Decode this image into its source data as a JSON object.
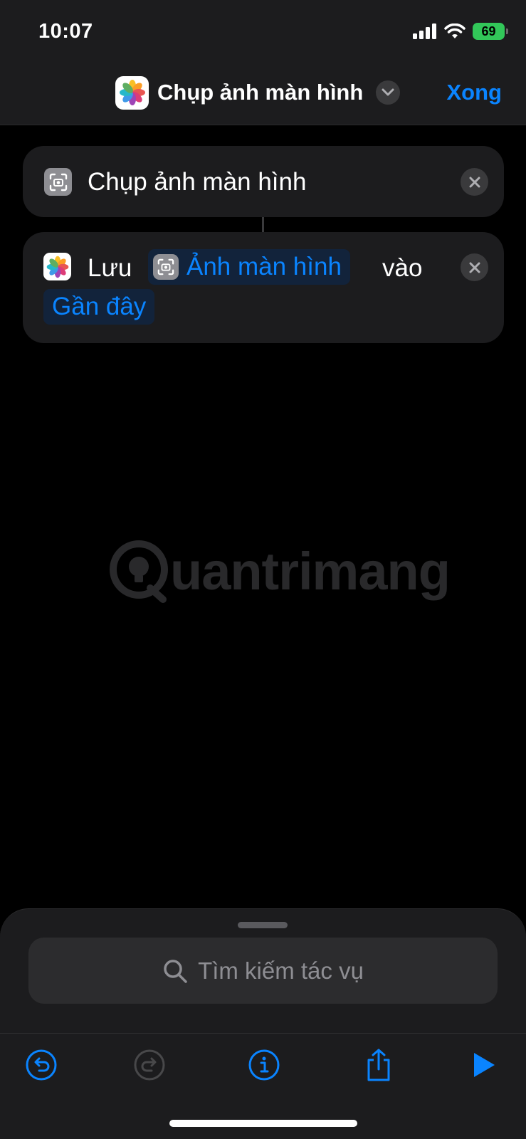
{
  "status_bar": {
    "time": "10:07",
    "battery": "69"
  },
  "nav": {
    "title": "Chụp ảnh màn hình",
    "done_label": "Xong"
  },
  "actions": [
    {
      "label": "Chụp ảnh màn hình"
    },
    {
      "prefix": "Lưu",
      "variable": "Ảnh màn hình",
      "connector": "vào",
      "destination": "Gần đây"
    }
  ],
  "watermark": {
    "text": "uantrimang"
  },
  "search": {
    "placeholder": "Tìm kiếm tác vụ"
  },
  "colors": {
    "accent": "#0a84ff",
    "background": "#000000",
    "card": "#1c1c1e",
    "battery": "#32c759"
  },
  "icons": {
    "app": "photos-icon",
    "screenshot": "screenshot-icon",
    "undo": "undo-icon",
    "redo": "redo-icon",
    "info": "info-icon",
    "share": "share-icon",
    "play": "play-icon"
  }
}
